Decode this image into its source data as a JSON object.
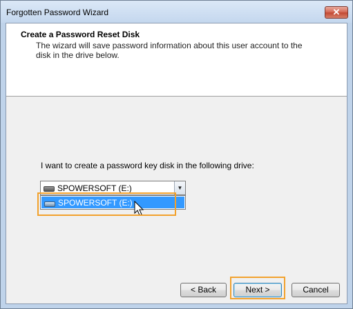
{
  "window": {
    "title": "Forgotten Password Wizard",
    "close_label": "✕"
  },
  "header": {
    "heading": "Create a Password Reset Disk",
    "description": "The wizard will save password information about this user account to the disk in the drive below."
  },
  "main": {
    "prompt": "I want to create a password key disk in the following drive:",
    "drive_select": {
      "selected": "SPOWERSOFT (E:)",
      "options": [
        "SPOWERSOFT (E:)"
      ]
    }
  },
  "buttons": {
    "back": "< Back",
    "next": "Next >",
    "cancel": "Cancel"
  },
  "colors": {
    "highlight": "#f2a12c",
    "selection": "#3399ff"
  }
}
